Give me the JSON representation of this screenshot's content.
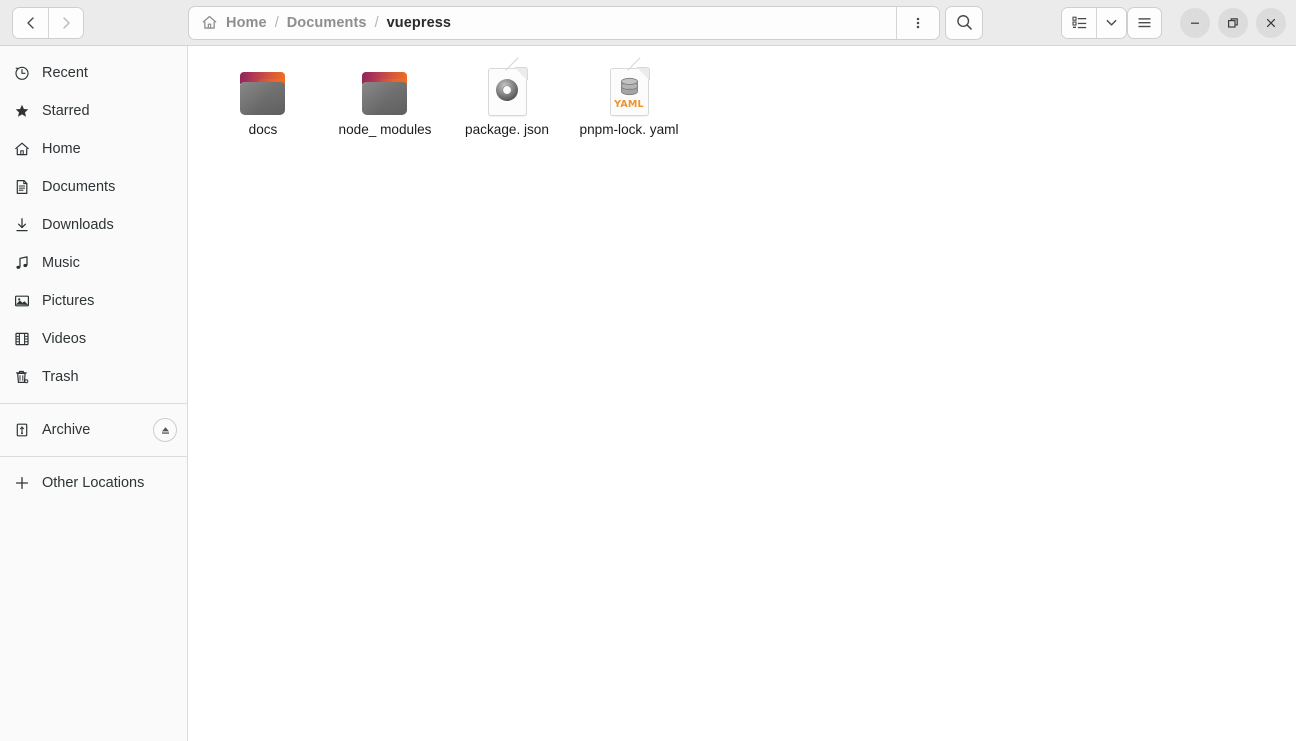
{
  "window": {
    "title": "vuepress"
  },
  "header": {
    "nav": {
      "back_label": "Back",
      "forward_label": "Forward"
    },
    "breadcrumb": {
      "home_icon": "home-icon",
      "separator": "/",
      "items": [
        {
          "label": "Home",
          "current": false
        },
        {
          "label": "Documents",
          "current": false
        },
        {
          "label": "vuepress",
          "current": true
        }
      ]
    },
    "buttons": {
      "path_menu": "kebab-icon",
      "search": "search-icon",
      "view_list": "list-view-icon",
      "view_dropdown": "chevron-down-icon",
      "main_menu": "hamburger-icon",
      "minimize": "minimize-icon",
      "maximize": "restore-icon",
      "close": "close-icon"
    }
  },
  "sidebar": {
    "items": [
      {
        "label": "Recent",
        "icon": "clock-icon"
      },
      {
        "label": "Starred",
        "icon": "star-icon"
      },
      {
        "label": "Home",
        "icon": "home-icon"
      },
      {
        "label": "Documents",
        "icon": "document-icon"
      },
      {
        "label": "Downloads",
        "icon": "download-icon"
      },
      {
        "label": "Music",
        "icon": "music-note-icon"
      },
      {
        "label": "Pictures",
        "icon": "image-icon"
      },
      {
        "label": "Videos",
        "icon": "film-icon"
      },
      {
        "label": "Trash",
        "icon": "trash-icon"
      }
    ],
    "devices": [
      {
        "label": "Archive",
        "icon": "usb-drive-icon",
        "eject": "eject-icon"
      }
    ],
    "other": {
      "label": "Other Locations",
      "icon": "plus-icon"
    }
  },
  "files": [
    {
      "name": "docs",
      "type": "folder"
    },
    {
      "name": "node_\nmodules",
      "type": "folder"
    },
    {
      "name": "package.\njson",
      "type": "json-file"
    },
    {
      "name": "pnpm-lock.\nyaml",
      "type": "yaml-file",
      "badge": "YAML"
    }
  ],
  "colors": {
    "headerbar_bg": "#ebebeb",
    "sidebar_bg": "#fafafa",
    "content_bg": "#ffffff",
    "crumb_inactive": "#8e8e8e",
    "crumb_active": "#2b2b2b",
    "folder_accent_start": "#8e2456",
    "folder_accent_end": "#f2701e",
    "folder_body": "#6f6f6f",
    "yaml_badge": "#f0922b"
  }
}
